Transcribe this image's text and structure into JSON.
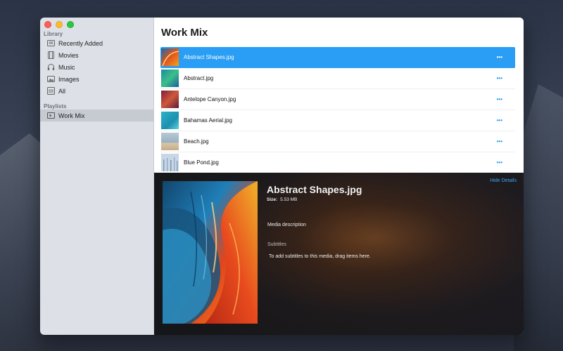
{
  "sidebar": {
    "library_title": "Library",
    "library_items": [
      {
        "label": "Recently Added",
        "icon": "recently-added-icon"
      },
      {
        "label": "Movies",
        "icon": "film-icon"
      },
      {
        "label": "Music",
        "icon": "headphones-icon"
      },
      {
        "label": "Images",
        "icon": "image-icon"
      },
      {
        "label": "All",
        "icon": "all-media-icon"
      }
    ],
    "playlists_title": "Playlists",
    "playlist_items": [
      {
        "label": "Work Mix",
        "icon": "playlist-icon",
        "selected": true
      }
    ]
  },
  "main": {
    "title": "Work Mix",
    "more_glyph": "•••",
    "rows": [
      {
        "name": "Abstract Shapes.jpg",
        "selected": true
      },
      {
        "name": "Abstract.jpg"
      },
      {
        "name": "Antelope Canyon.jpg"
      },
      {
        "name": "Bahamas Aerial.jpg"
      },
      {
        "name": "Beach.jpg"
      },
      {
        "name": "Blue Pond.jpg"
      }
    ]
  },
  "detail": {
    "hide_label": "Hide Details",
    "title": "Abstract Shapes.jpg",
    "size_label": "Size:",
    "size_value": "5.53 MB",
    "description": "Media description",
    "subtitles_label": "Subtitles",
    "subtitles_hint": "To add subtitles to this media, drag items here."
  },
  "colors": {
    "accent": "#2a9df4",
    "sidebar_bg": "#dde0e6",
    "selected_sidebar": "#c6cad1"
  }
}
